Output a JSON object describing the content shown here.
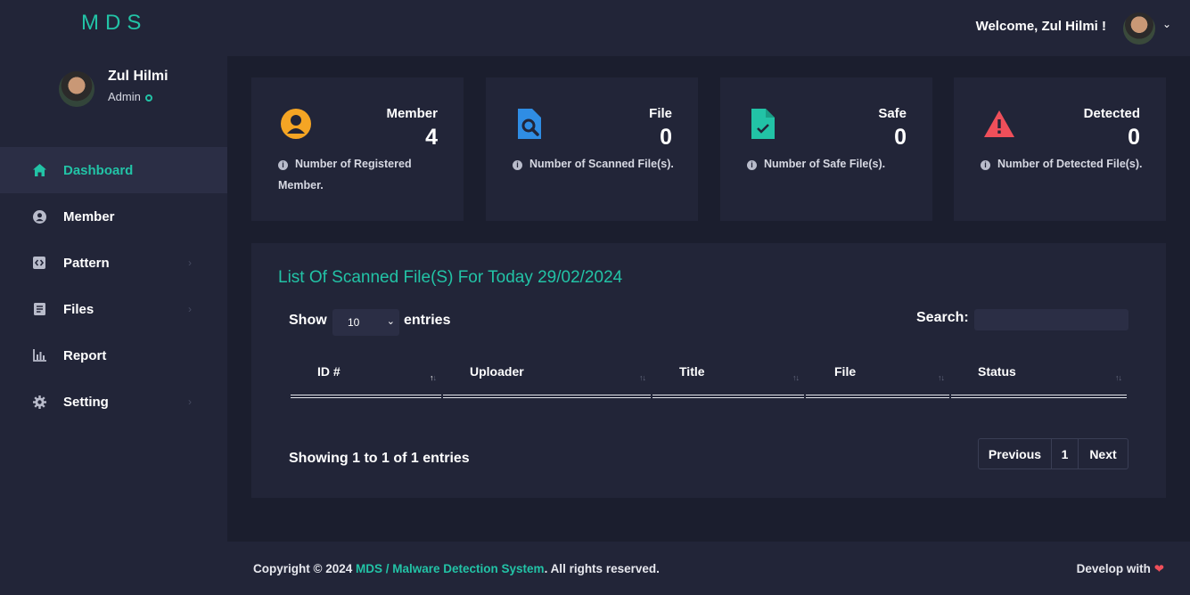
{
  "brand": "MDS",
  "header": {
    "welcome": "Welcome, Zul Hilmi !",
    "dropdown_icon": "chevron-down-icon"
  },
  "sidebar": {
    "user": {
      "name": "Zul Hilmi",
      "role": "Admin"
    },
    "items": [
      {
        "label": "Dashboard",
        "icon": "home-icon",
        "active": true
      },
      {
        "label": "Member",
        "icon": "user-circle-icon"
      },
      {
        "label": "Pattern",
        "icon": "code-icon"
      },
      {
        "label": "Files",
        "icon": "document-icon"
      },
      {
        "label": "Report",
        "icon": "bar-chart-icon"
      },
      {
        "label": "Setting",
        "icon": "gear-icon"
      }
    ]
  },
  "cards": [
    {
      "title": "Member",
      "value": "4",
      "desc": "Number of Registered Member.",
      "icon": "user-circle-icon",
      "color": "#f5a524"
    },
    {
      "title": "File",
      "value": "0",
      "desc": "Number of Scanned File(s).",
      "icon": "file-search-icon",
      "color": "#2f8de4"
    },
    {
      "title": "Safe",
      "value": "0",
      "desc": "Number of Safe File(s).",
      "icon": "file-check-icon",
      "color": "#22c3a6"
    },
    {
      "title": "Detected",
      "value": "0",
      "desc": "Number of Detected File(s).",
      "icon": "warning-icon",
      "color": "#ef4f5a"
    }
  ],
  "table": {
    "title": "List Of Scanned File(S) For Today 29/02/2024",
    "show_label": "Show",
    "entries_value": "10",
    "entries_label": "entries",
    "search_label": "Search:",
    "search_value": "",
    "columns": [
      "ID #",
      "Uploader",
      "Title",
      "File",
      "Status"
    ],
    "info": "Showing 1 to 1 of 1 entries",
    "pagination": {
      "previous": "Previous",
      "page": "1",
      "next": "Next"
    }
  },
  "footer": {
    "copyright_prefix": "Copyright © 2024 ",
    "link_text": "MDS / Malware Detection System",
    "copyright_suffix": ". All rights reserved.",
    "develop": "Develop with"
  },
  "colors": {
    "accent": "#22c3a6",
    "background": "#1b1e2e",
    "panel": "#222538",
    "heart": "#ef4f5a"
  }
}
